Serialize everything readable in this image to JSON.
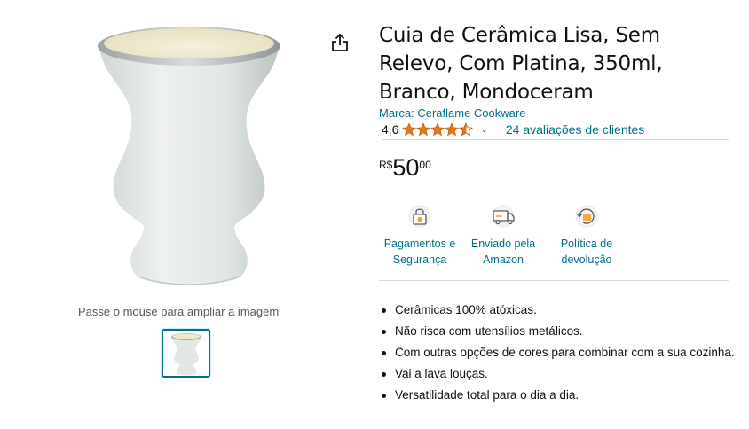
{
  "product": {
    "title": "Cuia de Cerâmica Lisa, Sem Relevo, Com Platina, 350ml, Branco, Mondoceram",
    "brand_link": "Marca: Ceraflame Cookware",
    "rating_value": "4,6",
    "rating_stars": 4.6,
    "reviews_link": "24 avaliações de clientes",
    "price": {
      "currency": "R$",
      "whole": "50",
      "fraction": "00"
    }
  },
  "gallery": {
    "zoom_hint": "Passe o mouse para ampliar a imagem",
    "thumbnail_count": 1
  },
  "features": [
    {
      "icon": "secure-payment-icon",
      "label_line1": "Pagamentos e",
      "label_line2": "Segurança"
    },
    {
      "icon": "delivery-truck-icon",
      "label_line1": "Enviado pela",
      "label_line2": "Amazon"
    },
    {
      "icon": "return-policy-icon",
      "label_line1": "Política de",
      "label_line2": "devolução"
    }
  ],
  "bullets": [
    "Cerâmicas 100% atóxicas.",
    "Não risca com utensílios metálicos.",
    "Com outras opções de cores para combinar com a sua cozinha.",
    "Vai a lava louças.",
    "Versatilidade total para o dia a dia."
  ],
  "colors": {
    "link": "#007185",
    "star": "#de7921",
    "text": "#0f1111",
    "muted": "#565959",
    "divider": "#d5d9d9",
    "cup_body": "#e6ebe7",
    "cup_rim": "#b9bdbd",
    "cup_interior": "#f1ecd6"
  }
}
